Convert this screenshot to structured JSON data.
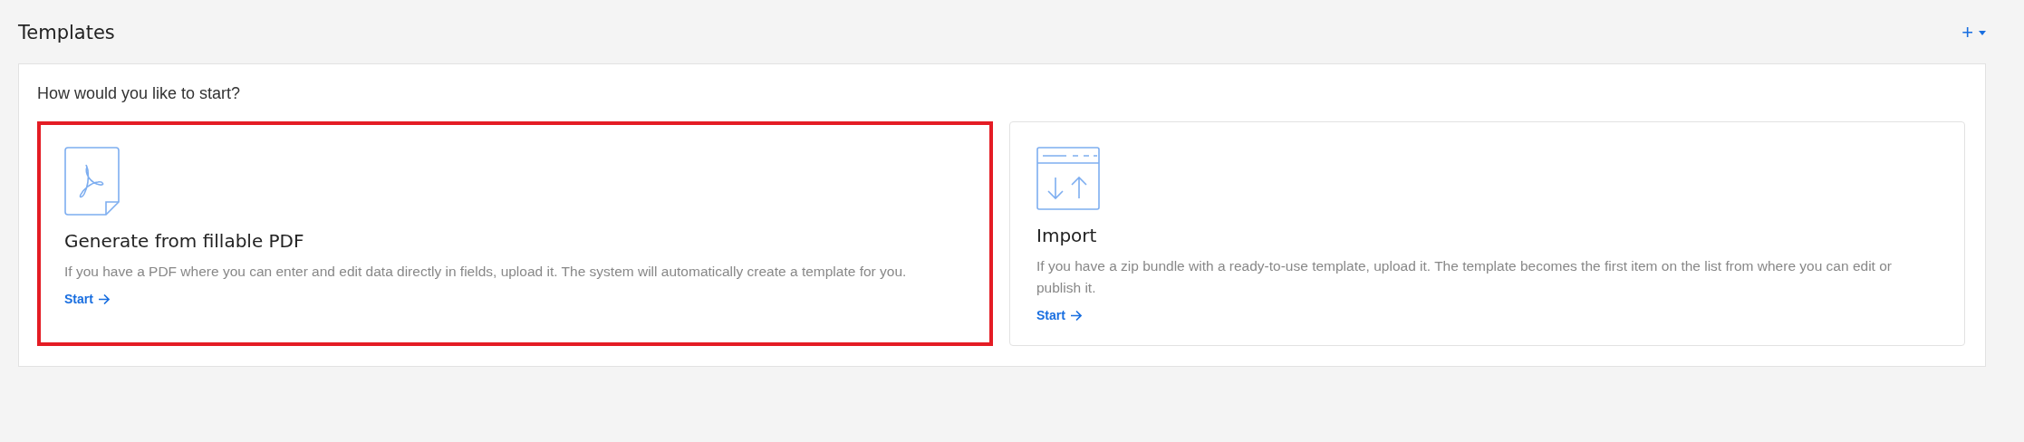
{
  "page": {
    "title": "Templates",
    "add_button": {
      "label": "+"
    }
  },
  "panel": {
    "prompt": "How would you like to start?",
    "options": [
      {
        "kind": "pdf",
        "title": "Generate from fillable PDF",
        "description": "If you have a PDF where you can enter and edit data directly in fields, upload it. The system will automatically create a template for you.",
        "action": "Start",
        "selected": true
      },
      {
        "kind": "import",
        "title": "Import",
        "description": "If you have a zip bundle with a ready-to-use template, upload it. The template becomes the first item on the list from where you can edit or publish it.",
        "action": "Start",
        "selected": false
      }
    ]
  }
}
